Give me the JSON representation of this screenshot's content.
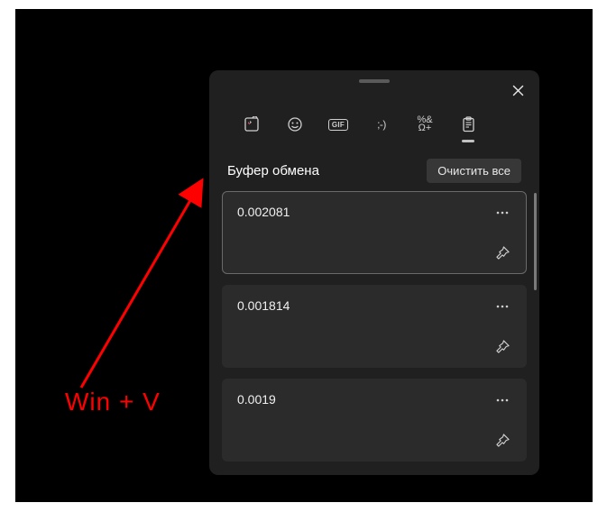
{
  "annotation": {
    "label": "Win  +  V"
  },
  "panel": {
    "title": "Буфер обмена",
    "clear_label": "Очистить все",
    "tabs": [
      {
        "name": "recent",
        "active": false
      },
      {
        "name": "emoji",
        "active": false
      },
      {
        "name": "gif",
        "active": false
      },
      {
        "name": "kaomoji",
        "active": false
      },
      {
        "name": "symbols",
        "active": false
      },
      {
        "name": "clipboard",
        "active": true
      }
    ],
    "items": [
      {
        "text": "0.002081",
        "active": true
      },
      {
        "text": "0.001814",
        "active": false
      },
      {
        "text": "0.0019",
        "active": false
      }
    ]
  }
}
